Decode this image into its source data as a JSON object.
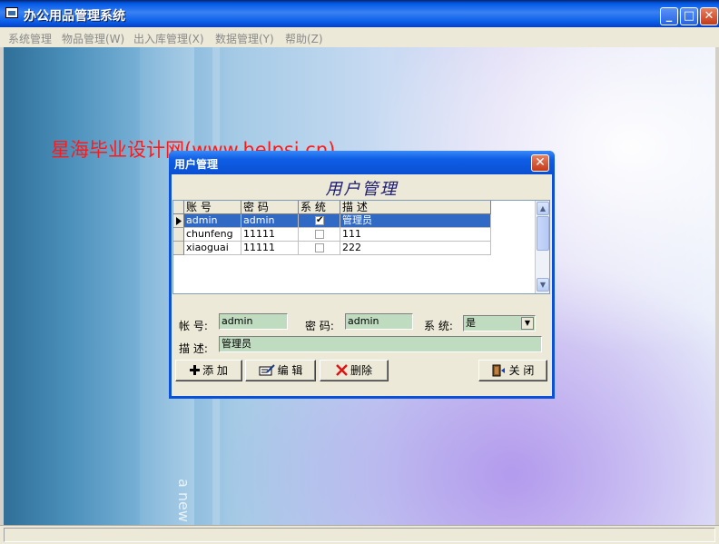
{
  "window": {
    "title": "办公用品管理系统",
    "min_label": "_",
    "max_label": "□",
    "close_label": "✕"
  },
  "menu": [
    {
      "label": "系统管理"
    },
    {
      "label": "物品管理(W)"
    },
    {
      "label": "出入库管理(X)"
    },
    {
      "label": "数据管理(Y)"
    },
    {
      "label": "帮助(Z)"
    }
  ],
  "background": {
    "watermark": "星海毕业设计网(www.helpsj.cn)",
    "vertical_text": "a new form"
  },
  "dialog": {
    "title": "用户管理",
    "close_label": "✕",
    "heading": "用户管理",
    "grid": {
      "headers": [
        "账 号",
        "密 码",
        "系 统",
        "描 述"
      ],
      "rows": [
        {
          "account": "admin",
          "password": "admin",
          "system": true,
          "desc": "管理员"
        },
        {
          "account": "chunfeng",
          "password": "11111",
          "system": false,
          "desc": "111"
        },
        {
          "account": "xiaoguai",
          "password": "11111",
          "system": false,
          "desc": "222"
        }
      ],
      "selected_row": 0
    },
    "form": {
      "account_label": "帐 号:",
      "account_value": "admin",
      "password_label": "密 码:",
      "password_value": "admin",
      "system_label": "系 统:",
      "system_value": "是",
      "desc_label": "描 述:",
      "desc_value": "管理员"
    },
    "buttons": {
      "add": "添 加",
      "edit": "编 辑",
      "delete": "删除",
      "close": "关 闭"
    }
  },
  "colors": {
    "title_blue": "#0058e6",
    "selection": "#316ac5",
    "field_bg": "#c0dcc0",
    "watermark": "#ff1a1a"
  }
}
